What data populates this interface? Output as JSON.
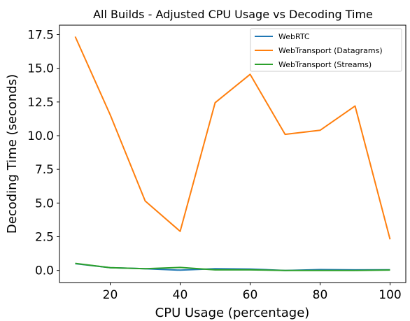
{
  "chart_data": {
    "type": "line",
    "title": "All Builds - Adjusted CPU Usage vs Decoding Time",
    "xlabel": "CPU Usage (percentage)",
    "ylabel": "Decoding Time (seconds)",
    "xlim": [
      5.5,
      104.5
    ],
    "ylim": [
      -0.9,
      18.2
    ],
    "xticks": [
      20,
      40,
      60,
      80,
      100
    ],
    "xtick_labels": [
      "20",
      "40",
      "60",
      "80",
      "100"
    ],
    "yticks": [
      0.0,
      2.5,
      5.0,
      7.5,
      10.0,
      12.5,
      15.0,
      17.5
    ],
    "ytick_labels": [
      "0.0",
      "2.5",
      "5.0",
      "7.5",
      "10.0",
      "12.5",
      "15.0",
      "17.5"
    ],
    "grid": false,
    "legend_position": "top-right",
    "x": [
      10,
      20,
      30,
      40,
      50,
      60,
      70,
      80,
      90,
      100
    ],
    "series": [
      {
        "name": "WebRTC",
        "color": "#1f77b4",
        "values": [
          0.5,
          0.2,
          0.12,
          0.02,
          0.12,
          0.1,
          0.0,
          0.06,
          0.04,
          0.05
        ]
      },
      {
        "name": "WebTransport (Datagrams)",
        "color": "#ff7f0e",
        "values": [
          17.35,
          11.55,
          5.15,
          2.9,
          12.45,
          14.55,
          10.1,
          10.4,
          12.2,
          2.3
        ]
      },
      {
        "name": "WebTransport (Streams)",
        "color": "#2ca02c",
        "values": [
          0.52,
          0.2,
          0.12,
          0.22,
          0.04,
          0.04,
          0.0,
          0.0,
          0.0,
          0.03
        ]
      }
    ]
  }
}
